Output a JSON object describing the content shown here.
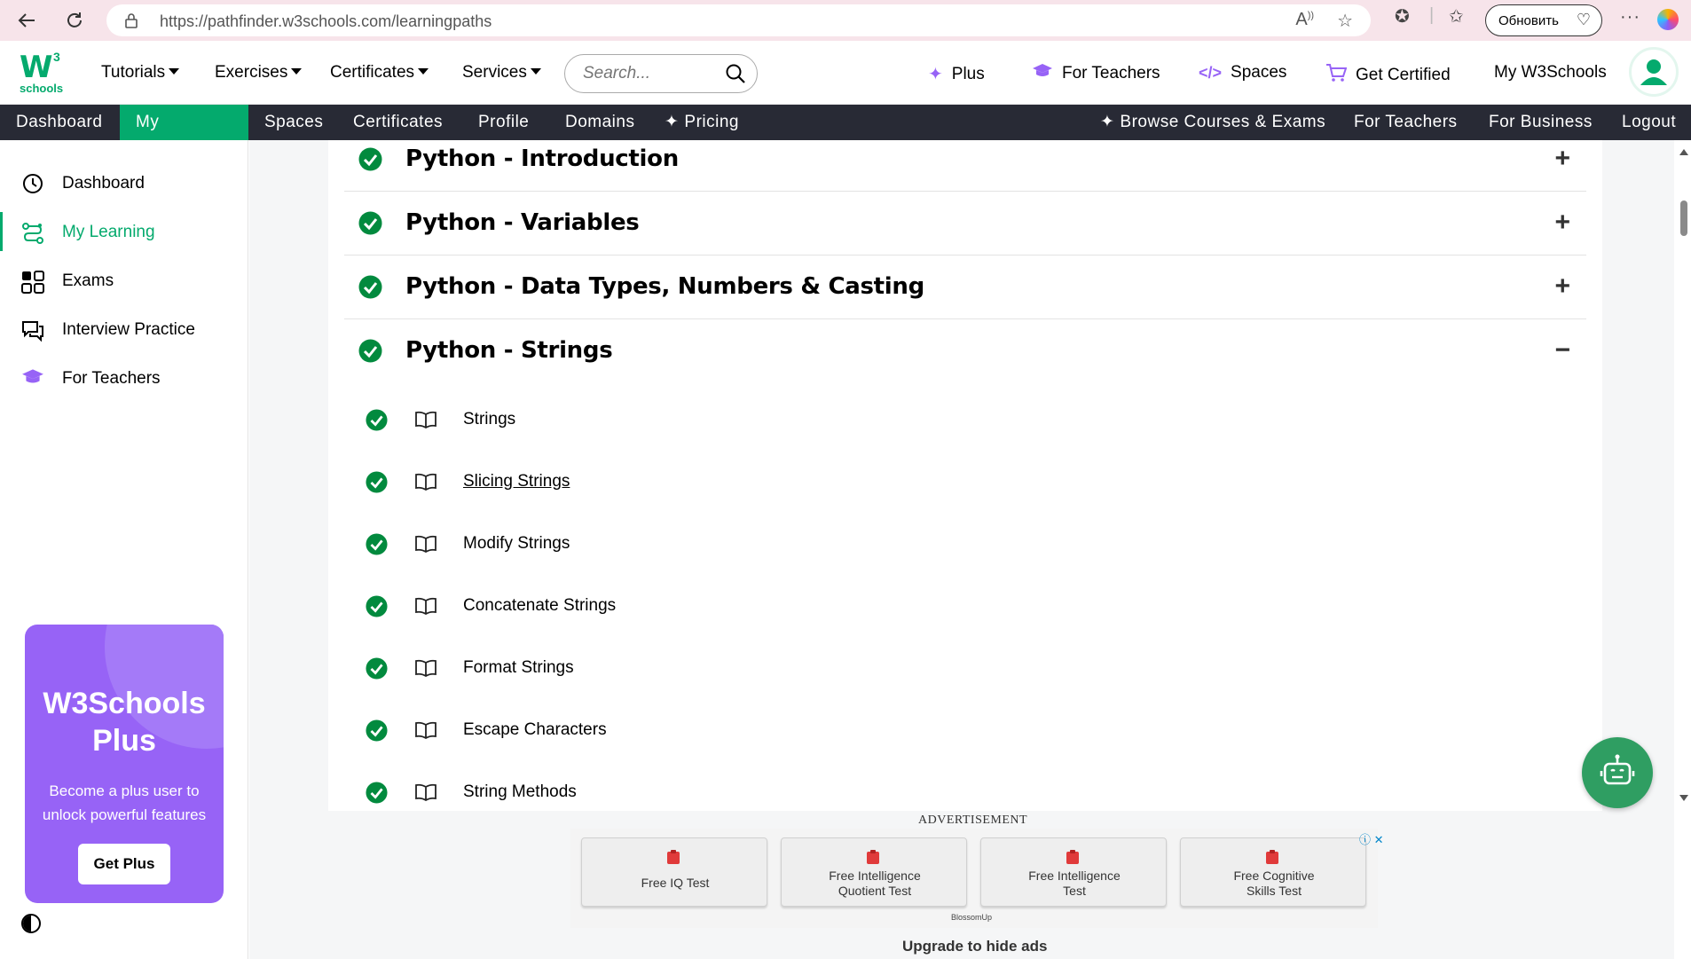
{
  "browser": {
    "url": "https://pathfinder.w3schools.com/learningpaths",
    "update_label": "Обновить"
  },
  "topnav": {
    "logo_w": "W",
    "logo_sup": "3",
    "logo_sub": "schools",
    "menus": [
      "Tutorials",
      "Exercises",
      "Certificates",
      "Services"
    ],
    "search_placeholder": "Search...",
    "right": {
      "plus": "Plus",
      "for_teachers": "For Teachers",
      "spaces": "Spaces",
      "get_certified": "Get Certified",
      "my_w3schools": "My W3Schools"
    }
  },
  "subnav": {
    "left": [
      "Dashboard",
      "My Learning",
      "Spaces",
      "Certificates",
      "Profile",
      "Domains",
      "Pricing"
    ],
    "right": [
      "Browse Courses & Exams",
      "For Teachers",
      "For Business",
      "Logout"
    ]
  },
  "sidebar": {
    "items": [
      "Dashboard",
      "My Learning",
      "Exams",
      "Interview Practice",
      "For Teachers"
    ],
    "plus_card": {
      "title_line1": "W3Schools",
      "title_line2": "Plus",
      "subtitle": "Become a plus user to unlock powerful features",
      "button": "Get Plus"
    }
  },
  "sections": [
    {
      "title": "Python - Introduction",
      "toggle": "+"
    },
    {
      "title": "Python - Variables",
      "toggle": "+"
    },
    {
      "title": "Python - Data Types, Numbers & Casting",
      "toggle": "+"
    },
    {
      "title": "Python - Strings",
      "toggle": "−"
    }
  ],
  "lessons": [
    "Strings",
    "Slicing Strings",
    "Modify Strings",
    "Concatenate Strings",
    "Format Strings",
    "Escape Characters",
    "String Methods"
  ],
  "ad": {
    "label": "ADVERTISEMENT",
    "tiles": [
      {
        "line1": "Free IQ Test",
        "line2": ""
      },
      {
        "line1": "Free Intelligence",
        "line2": "Quotient Test"
      },
      {
        "line1": "Free Intelligence",
        "line2": "Test"
      },
      {
        "line1": "Free Cognitive",
        "line2": "Skills Test"
      }
    ],
    "brand": "BlossomUp",
    "upgrade": "Upgrade to hide ads"
  },
  "colors": {
    "brand_green": "#04aa6d",
    "plus_purple": "#9763f6",
    "subnav_bg": "#282a35",
    "check_green": "#028a3e"
  }
}
